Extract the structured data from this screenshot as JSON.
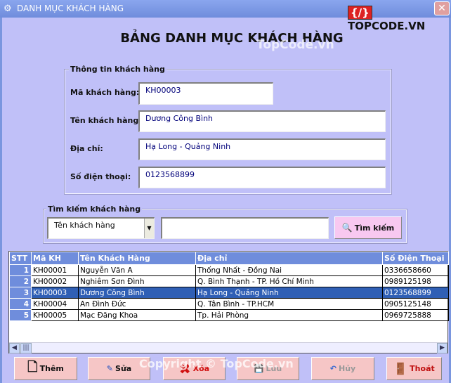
{
  "window": {
    "title": "DANH MỤC KHÁCH HÀNG",
    "close": "✕",
    "logo": "TOPCODE.VN",
    "logo_mark": "{/}"
  },
  "heading": "BẢNG DANH MỤC KHÁCH HÀNG",
  "watermark": "TopCode.vn",
  "info": {
    "legend": "Thông tin khách hàng",
    "ma_label": "Mã khách hàng:",
    "ma_value": "KH00003",
    "ten_label": "Tên khách hàng:",
    "ten_value": "Dương Công Bình",
    "diachi_label": "Địa chỉ:",
    "diachi_value": "Hạ Long - Quảng Ninh",
    "sdt_label": "Số điện thoại:",
    "sdt_value": "0123568899"
  },
  "search": {
    "legend": "Tìm kiếm khách hàng",
    "field": "Tên khách hàng",
    "query": "",
    "button": "Tìm kiếm"
  },
  "table": {
    "columns": [
      "STT",
      "Mã KH",
      "Tên Khách Hàng",
      "Địa chỉ",
      "Số Điện Thoại"
    ],
    "rows": [
      [
        "1",
        "KH00001",
        "Nguyễn Văn A",
        "Thống Nhất - Đồng Nai",
        "0336658660"
      ],
      [
        "2",
        "KH00002",
        "Nghiêm Sơn Đình",
        "Q. Bình Thạnh - TP. Hồ Chí Minh",
        "0989125198"
      ],
      [
        "3",
        "KH00003",
        "Dương Công Bình",
        "Hạ Long - Quảng Ninh",
        "0123568899"
      ],
      [
        "4",
        "KH00004",
        "An Đình Đức",
        "Q. Tân Bình - TP.HCM",
        "0905125148"
      ],
      [
        "5",
        "KH00005",
        "Mạc Đăng Khoa",
        "Tp. Hải Phòng",
        "0969725888"
      ]
    ],
    "selected_row": 3
  },
  "buttons": {
    "them": "Thêm",
    "sua": "Sửa",
    "xoa": "Xóa",
    "luu": "Lưu",
    "huy": "Hủy",
    "thoat": "Thoát"
  },
  "copyright": "Copyright © TopCode.vn"
}
